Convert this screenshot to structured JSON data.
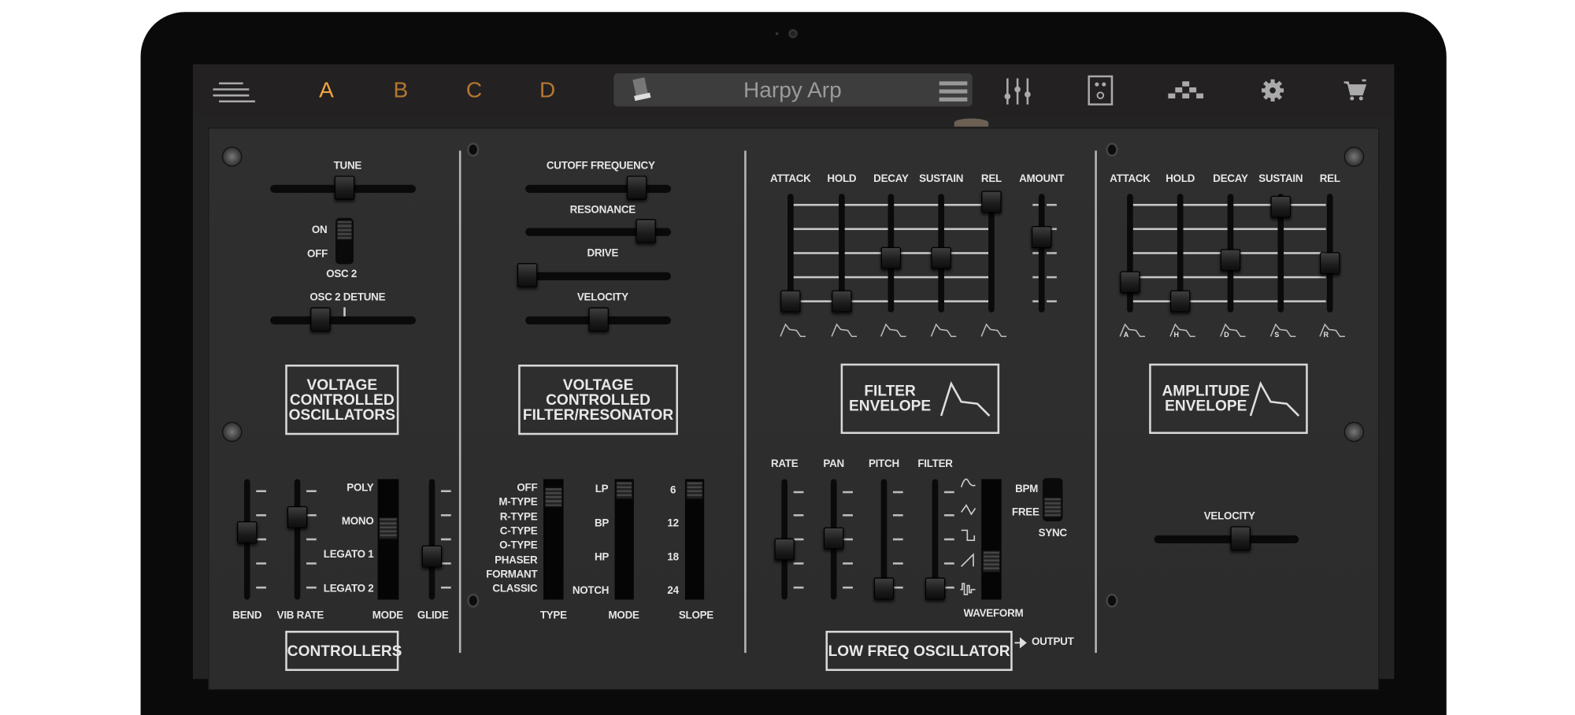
{
  "topbar": {
    "menu_icon": "hamburger-icon",
    "slots": [
      "A",
      "B",
      "C",
      "D"
    ],
    "active_slot": "A",
    "preset_name": "Harpy Arp",
    "icons": [
      "keyboard-icon",
      "list-icon",
      "mixer-icon",
      "speaker-icon",
      "sequencer-icon",
      "gear-icon",
      "cart-icon"
    ]
  },
  "vco": {
    "tune": {
      "label": "TUNE",
      "value": 0.51
    },
    "osc2": {
      "on_label": "ON",
      "off_label": "OFF",
      "label": "OSC 2",
      "state": "ON"
    },
    "detune": {
      "label": "OSC 2 DETUNE",
      "value": 0.32
    },
    "title": [
      "VOLTAGE",
      "CONTROLLED",
      "OSCILLATORS"
    ]
  },
  "controllers": {
    "bend": {
      "label": "BEND",
      "value": 0.57
    },
    "vib_rate": {
      "label": "VIB RATE",
      "value": 0.73
    },
    "mode": {
      "label": "MODE",
      "options": [
        "POLY",
        "MONO",
        "LEGATO 1",
        "LEGATO 2"
      ],
      "selected": "MONO"
    },
    "glide": {
      "label": "GLIDE",
      "value": 0.32
    },
    "title": "CONTROLLERS"
  },
  "vcf": {
    "cutoff": {
      "label": "CUTOFF FREQUENCY",
      "value": 0.81
    },
    "resonance": {
      "label": "RESONANCE",
      "value": 0.88
    },
    "drive": {
      "label": "DRIVE",
      "value": 0.0
    },
    "velocity": {
      "label": "VELOCITY",
      "value": 0.5
    },
    "title": [
      "VOLTAGE",
      "CONTROLLED",
      "FILTER/RESONATOR"
    ],
    "type": {
      "label": "TYPE",
      "options": [
        "OFF",
        "M-TYPE",
        "R-TYPE",
        "C-TYPE",
        "O-TYPE",
        "PHASER",
        "FORMANT",
        "CLASSIC"
      ],
      "selected": "M-TYPE"
    },
    "mode": {
      "label": "MODE",
      "options": [
        "LP",
        "BP",
        "HP",
        "NOTCH"
      ],
      "selected": "LP"
    },
    "slope": {
      "label": "SLOPE",
      "options": [
        "6",
        "12",
        "18",
        "24"
      ],
      "selected": "6"
    }
  },
  "filter_env": {
    "sliders": [
      {
        "label": "ATTACK",
        "value": 0.0
      },
      {
        "label": "HOLD",
        "value": 0.0
      },
      {
        "label": "DECAY",
        "value": 0.43
      },
      {
        "label": "SUSTAIN",
        "value": 0.43
      },
      {
        "label": "REL",
        "value": 1.0
      }
    ],
    "amount": {
      "label": "AMOUNT",
      "value": 0.65
    },
    "title": [
      "FILTER",
      "ENVELOPE"
    ]
  },
  "lfo": {
    "sliders": [
      {
        "label": "RATE",
        "value": 0.4
      },
      {
        "label": "PAN",
        "value": 0.52
      },
      {
        "label": "PITCH",
        "value": 0.0
      },
      {
        "label": "FILTER",
        "value": 0.0
      }
    ],
    "waveform": {
      "label": "WAVEFORM",
      "options": [
        "sine",
        "triangle",
        "square",
        "saw",
        "random"
      ],
      "selected": "saw"
    },
    "sync": {
      "label": "SYNC",
      "options": [
        "BPM",
        "FREE"
      ],
      "selected": "FREE"
    },
    "title": "LOW FREQ OSCILLATOR",
    "output_label": "OUTPUT"
  },
  "amp_env": {
    "sliders": [
      {
        "label": "ATTACK",
        "marker": "A",
        "value": 0.19
      },
      {
        "label": "HOLD",
        "marker": "H",
        "value": 0.0
      },
      {
        "label": "DECAY",
        "marker": "D",
        "value": 0.41
      },
      {
        "label": "SUSTAIN",
        "marker": "S",
        "value": 0.95
      },
      {
        "label": "REL",
        "marker": "R",
        "value": 0.38
      }
    ],
    "title": [
      "AMPLITUDE",
      "ENVELOPE"
    ],
    "velocity": {
      "label": "VELOCITY",
      "value": 0.61
    }
  }
}
